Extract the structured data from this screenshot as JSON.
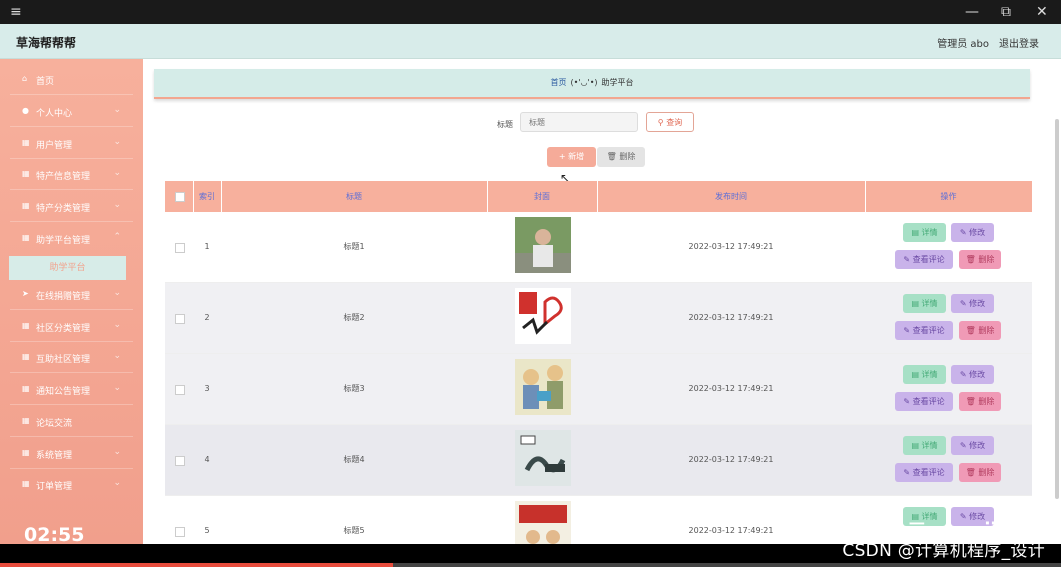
{
  "window": {
    "menu_icon": "hamburger-icon",
    "minimize": "—",
    "restore": "⧉",
    "close": "✕"
  },
  "header": {
    "brand": "草海帮帮帮",
    "admin_text": "管理员 abo",
    "logout": "退出登录"
  },
  "sidebar": {
    "items": [
      {
        "label": "首页",
        "icon": "home-icon"
      },
      {
        "label": "个人中心",
        "icon": "user-icon"
      },
      {
        "label": "用户管理",
        "icon": "grid-icon"
      },
      {
        "label": "特产信息管理",
        "icon": "grid-icon"
      },
      {
        "label": "特产分类管理",
        "icon": "grid-icon"
      },
      {
        "label": "助学平台管理",
        "icon": "grid-icon"
      },
      {
        "label": "在线捐赠管理",
        "icon": "send-icon"
      },
      {
        "label": "社区分类管理",
        "icon": "grid-icon"
      },
      {
        "label": "互助社区管理",
        "icon": "grid-icon"
      },
      {
        "label": "通知公告管理",
        "icon": "grid-icon"
      },
      {
        "label": "论坛交流",
        "icon": "grid-icon"
      },
      {
        "label": "系统管理",
        "icon": "grid-icon"
      },
      {
        "label": "订单管理",
        "icon": "grid-icon"
      }
    ],
    "active_sub": "助学平台"
  },
  "video": {
    "time": "02:55",
    "progress_percent": 37
  },
  "breadcrumb": {
    "home": "首页",
    "separator": "(•'◡'•)",
    "current": "助学平台"
  },
  "search": {
    "label": "标题",
    "placeholder": "标题",
    "query_button": "查询"
  },
  "toolbar": {
    "add": "新增",
    "delete": "删除"
  },
  "table": {
    "headers": [
      "索引",
      "标题",
      "封面",
      "发布时间",
      "操作"
    ],
    "rows": [
      {
        "index": "1",
        "title": "标题1",
        "time": "2022-03-12 17:49:21"
      },
      {
        "index": "2",
        "title": "标题2",
        "time": "2022-03-12 17:49:21"
      },
      {
        "index": "3",
        "title": "标题3",
        "time": "2022-03-12 17:49:21"
      },
      {
        "index": "4",
        "title": "标题4",
        "time": "2022-03-12 17:49:21"
      },
      {
        "index": "5",
        "title": "标题5",
        "time": "2022-03-12 17:49:21"
      }
    ],
    "actions": {
      "detail": "详情",
      "edit": "修改",
      "review": "查看评论",
      "delete": "删除"
    }
  },
  "watermark": "CSDN @计算机程序_设计"
}
